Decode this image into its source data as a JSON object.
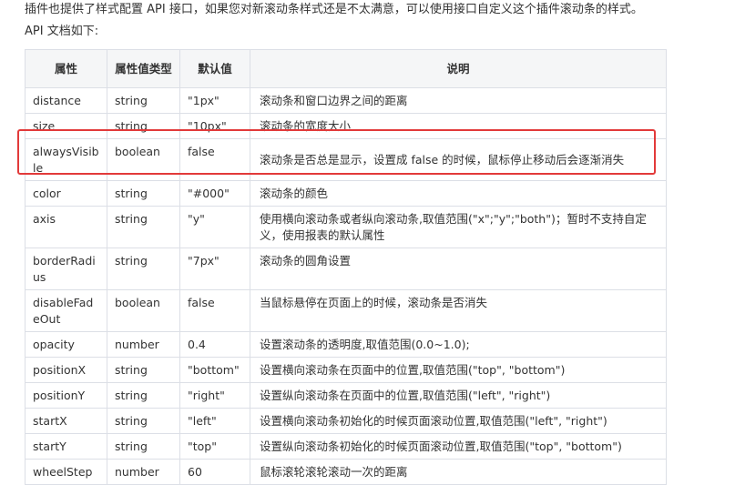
{
  "intro": {
    "line1": "插件也提供了样式配置 API 接口，如果您对新滚动条样式还是不太满意，可以使用接口自定义这个插件滚动条的样式。",
    "line2": "API 文档如下:"
  },
  "table": {
    "headers": {
      "attr": "属性",
      "type": "属性值类型",
      "default": "默认值",
      "desc": "说明"
    },
    "rows": [
      {
        "attr": "distance",
        "type": "string",
        "default": "\"1px\"",
        "desc": "滚动条和窗口边界之间的距离"
      },
      {
        "attr": "size",
        "type": "string",
        "default": "\"10px\"",
        "desc": "滚动条的宽度大小"
      },
      {
        "attr": "alwaysVisible",
        "type": "boolean",
        "default": "false",
        "desc": "滚动条是否总是显示，设置成 false 的时候，鼠标停止移动后会逐渐消失"
      },
      {
        "attr": "color",
        "type": "string",
        "default": "\"#000\"",
        "desc": "滚动条的颜色"
      },
      {
        "attr": "axis",
        "type": "string",
        "default": "\"y\"",
        "desc": "使用横向滚动条或者纵向滚动条,取值范围(\"x\";\"y\";\"both\")；暂时不支持自定义，使用报表的默认属性"
      },
      {
        "attr": "borderRadius",
        "type": "string",
        "default": "\"7px\"",
        "desc": "滚动条的圆角设置"
      },
      {
        "attr": "disableFadeOut",
        "type": "boolean",
        "default": "false",
        "desc": "当鼠标悬停在页面上的时候，滚动条是否消失"
      },
      {
        "attr": "opacity",
        "type": "number",
        "default": "0.4",
        "desc": "设置滚动条的透明度,取值范围(0.0~1.0);"
      },
      {
        "attr": "positionX",
        "type": "string",
        "default": "\"bottom\"",
        "desc": "设置横向滚动条在页面中的位置,取值范围(\"top\", \"bottom\")"
      },
      {
        "attr": "positionY",
        "type": "string",
        "default": "\"right\"",
        "desc": "设置纵向滚动条在页面中的位置,取值范围(\"left\", \"right\")"
      },
      {
        "attr": "startX",
        "type": "string",
        "default": "\"left\"",
        "desc": "设置横向滚动条初始化的时候页面滚动位置,取值范围(\"left\", \"right\")"
      },
      {
        "attr": "startY",
        "type": "string",
        "default": "\"top\"",
        "desc": "设置纵向滚动条初始化的时候页面滚动位置,取值范围(\"top\", \"bottom\")"
      },
      {
        "attr": "wheelStep",
        "type": "number",
        "default": "60",
        "desc": "鼠标滚轮滚轮滚动一次的距离"
      }
    ]
  },
  "highlight": {
    "color": "#e23a3a",
    "row": "alwaysVisible"
  }
}
